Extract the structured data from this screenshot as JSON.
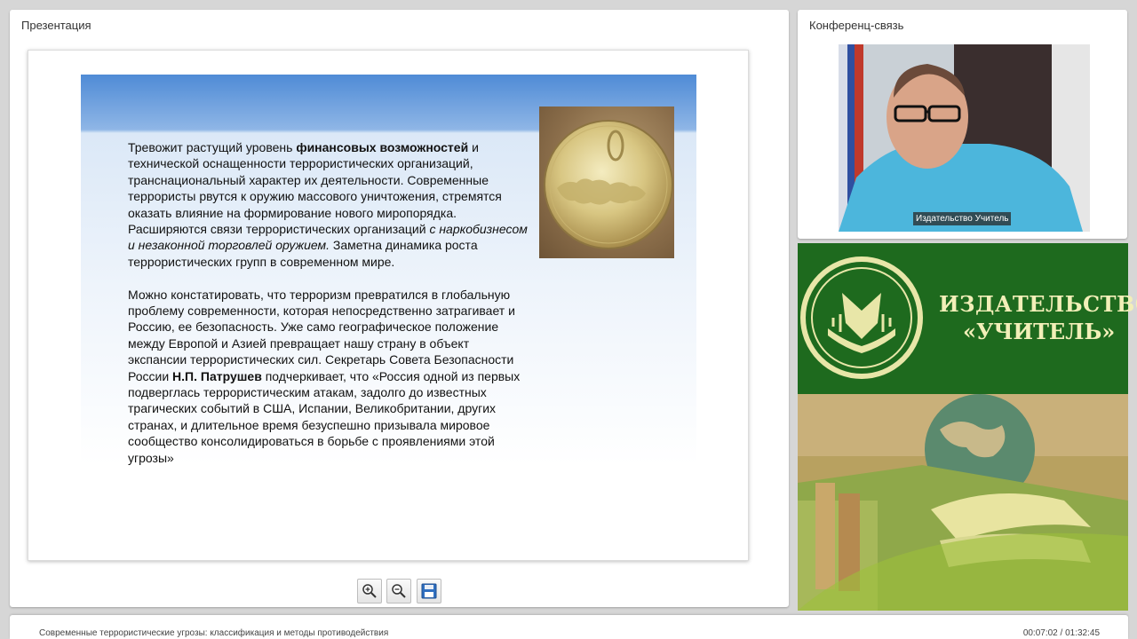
{
  "presentation": {
    "panel_title": "Презентация",
    "slide": {
      "p1_a": "Тревожит растущий уровень ",
      "p1_b": "финансовых возможностей",
      "p1_c": " и технической оснащенности террористических организаций, транснациональный характер их деятельности. Современные террористы рвутся к оружию массового уничтожения, стремятся оказать влияние на формирование нового миропорядка. Расширяются связи террористических организаций ",
      "p1_d": "с наркобизнесом и незаконной торговлей оружием.",
      "p1_e": " Заметна динамика роста террористических групп в современном мире.",
      "p2_a": "Можно констатировать, что терроризм превратился в глобальную проблему современности, которая непосредственно затрагивает и Россию, ее безопасность. Уже само географическое положение между Европой и Азией превращает нашу страну в объект экспансии террористических сил. Секретарь Совета Безопасности России ",
      "p2_b": "Н.П. Патрушев",
      "p2_c": " подчеркивает, что «Россия одной из первых подверглась террористическим атакам, задолго до известных трагических событий в США, Испании, Великобритании, других странах, и длительное время безуспешно призывала мировое сообщество консолидироваться в борьбе с проявлениями этой угрозы»"
    },
    "toolbar": {
      "zoom_in_icon": "zoom-in-icon",
      "zoom_out_icon": "zoom-out-icon",
      "save_icon": "save-icon"
    }
  },
  "conference": {
    "panel_title": "Конференц-связь",
    "video_caption": "Издательство Учитель"
  },
  "banner": {
    "line1": "ИЗДАТЕЛЬСТВО",
    "line2": "«УЧИТЕЛЬ»"
  },
  "bottom_bar": {
    "lecture_title": "Современные террористические угрозы: классификация и методы противодействия",
    "time": "00:07:02 / 01:32:45"
  },
  "colors": {
    "banner_green": "#1e6a1e",
    "logo_cream": "#f2efb8",
    "slide_header_blue": "#4f8bd6"
  }
}
